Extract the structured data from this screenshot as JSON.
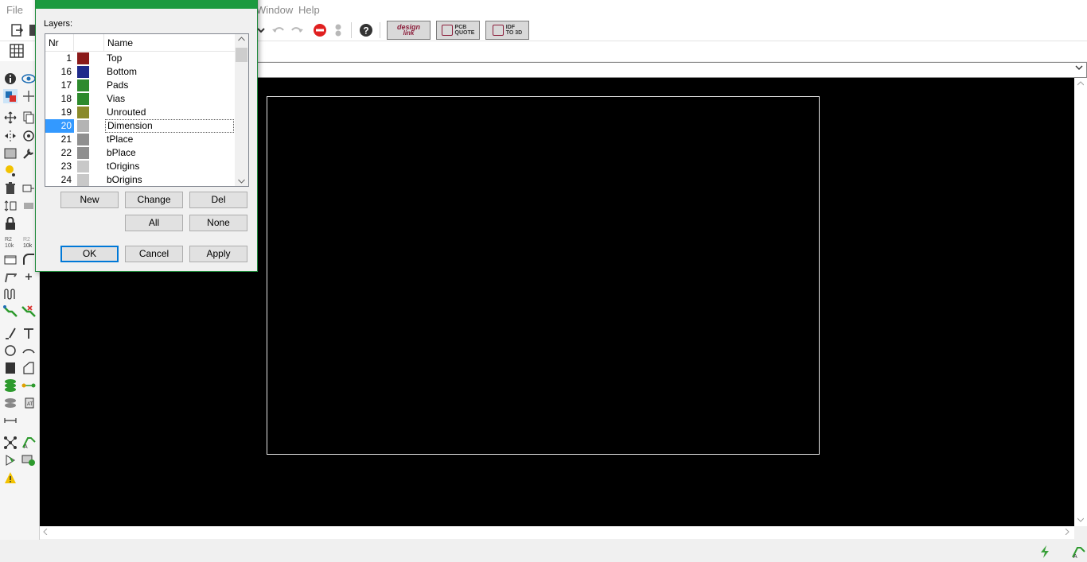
{
  "menu": {
    "items": [
      {
        "id": "file",
        "label": "File"
      },
      {
        "id": "window",
        "label": "Window"
      },
      {
        "id": "help",
        "label": "Help"
      }
    ]
  },
  "toolbar": {
    "logos": {
      "design_link": {
        "line1": "design",
        "line2": "link"
      },
      "pcb_quote": {
        "line1": "PCB",
        "line2": "QUOTE"
      },
      "idf_to_3d": {
        "line1": "IDF",
        "line2": "TO 3D"
      }
    }
  },
  "dialog": {
    "layers_label": "Layers:",
    "table": {
      "headers": {
        "nr": "Nr",
        "name": "Name"
      },
      "rows": [
        {
          "nr": "1",
          "name": "Top",
          "color": "#8b1a1a"
        },
        {
          "nr": "16",
          "name": "Bottom",
          "color": "#1f2a8a"
        },
        {
          "nr": "17",
          "name": "Pads",
          "color": "#2d8a2d"
        },
        {
          "nr": "18",
          "name": "Vias",
          "color": "#2d8a2d"
        },
        {
          "nr": "19",
          "name": "Unrouted",
          "color": "#8a8a2a"
        },
        {
          "nr": "20",
          "name": "Dimension",
          "color": "#b4b4b4",
          "selected": true
        },
        {
          "nr": "21",
          "name": "tPlace",
          "color": "#8f8f8f"
        },
        {
          "nr": "22",
          "name": "bPlace",
          "color": "#8f8f8f"
        },
        {
          "nr": "23",
          "name": "tOrigins",
          "color": "#c8c8c8"
        },
        {
          "nr": "24",
          "name": "bOrigins",
          "color": "#c8c8c8"
        }
      ]
    },
    "buttons": {
      "new": "New",
      "change": "Change",
      "del": "Del",
      "all": "All",
      "none": "None",
      "ok": "OK",
      "cancel": "Cancel",
      "apply": "Apply"
    }
  },
  "colors": {
    "dialog_title": "#1c9a3f",
    "selection": "#3399ff",
    "canvas": "#000000",
    "board_outline": "#e6e6e6"
  }
}
